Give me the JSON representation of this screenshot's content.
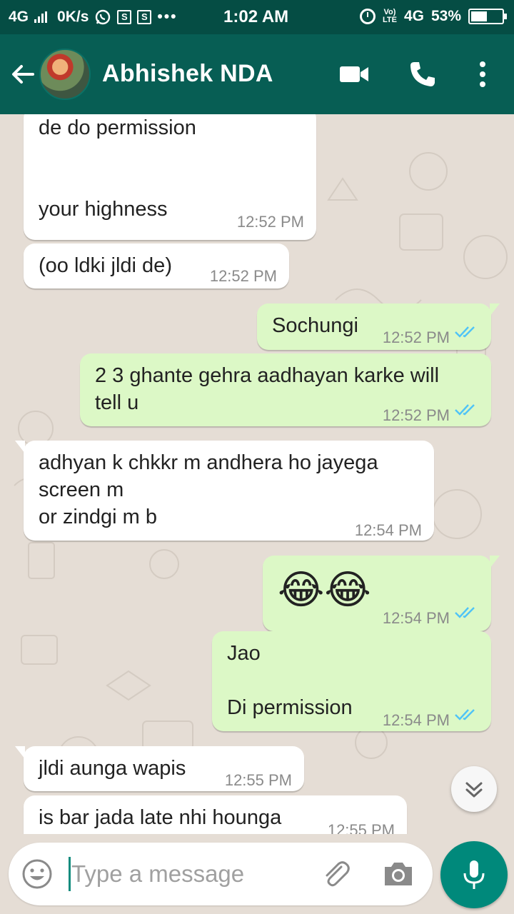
{
  "status_bar": {
    "network_left": "4G",
    "speed": "0K/s",
    "time": "1:02 AM",
    "volte_top": "Vo)",
    "volte_bottom": "LTE",
    "network_right": "4G",
    "battery": "53%",
    "battery_level": 0.53,
    "icons": [
      "signal-icon",
      "whatsapp-icon",
      "s-notification-icon",
      "s-notification-icon",
      "more-notifications-icon",
      "alarm-icon",
      "battery-icon"
    ]
  },
  "header": {
    "contact_name": "Abhishek NDA",
    "icons": [
      "back-arrow-icon",
      "avatar",
      "video-call-icon",
      "phone-icon",
      "more-vert-icon"
    ]
  },
  "colors": {
    "header": "#075e54",
    "status_bar": "#054d44",
    "incoming_bubble": "#ffffff",
    "outgoing_bubble": "#dcf8c6",
    "read_ticks": "#4fc3f7",
    "mic_button": "#00897b",
    "wallpaper": "#e5ddd5"
  },
  "messages": [
    {
      "direction": "in",
      "text": "de do permission\n\n\nyour highness",
      "time": "12:52 PM"
    },
    {
      "direction": "in",
      "text": "(oo ldki jldi de)",
      "time": "12:52 PM"
    },
    {
      "direction": "out",
      "text": "Sochungi",
      "time": "12:52 PM",
      "status": "read"
    },
    {
      "direction": "out",
      "text": "2 3 ghante gehra aadhayan karke will\ntell u",
      "time": "12:52 PM",
      "status": "read"
    },
    {
      "direction": "in",
      "text": "adhyan k chkkr m andhera ho jayega\nscreen m\nor zindgi m b",
      "time": "12:54 PM"
    },
    {
      "direction": "out",
      "text": "😂😂",
      "time": "12:54 PM",
      "status": "read"
    },
    {
      "direction": "out",
      "text": "Jao\n\nDi permission",
      "time": "12:54 PM",
      "status": "read"
    },
    {
      "direction": "in",
      "text": "jldi aunga wapis",
      "time": "12:55 PM"
    },
    {
      "direction": "in",
      "text": "is bar jada late nhi hounga",
      "time": "12:55 PM"
    }
  ],
  "composer": {
    "placeholder": "Type a message",
    "value": "",
    "icons": [
      "emoji-icon",
      "attach-icon",
      "camera-icon",
      "mic-icon"
    ]
  }
}
